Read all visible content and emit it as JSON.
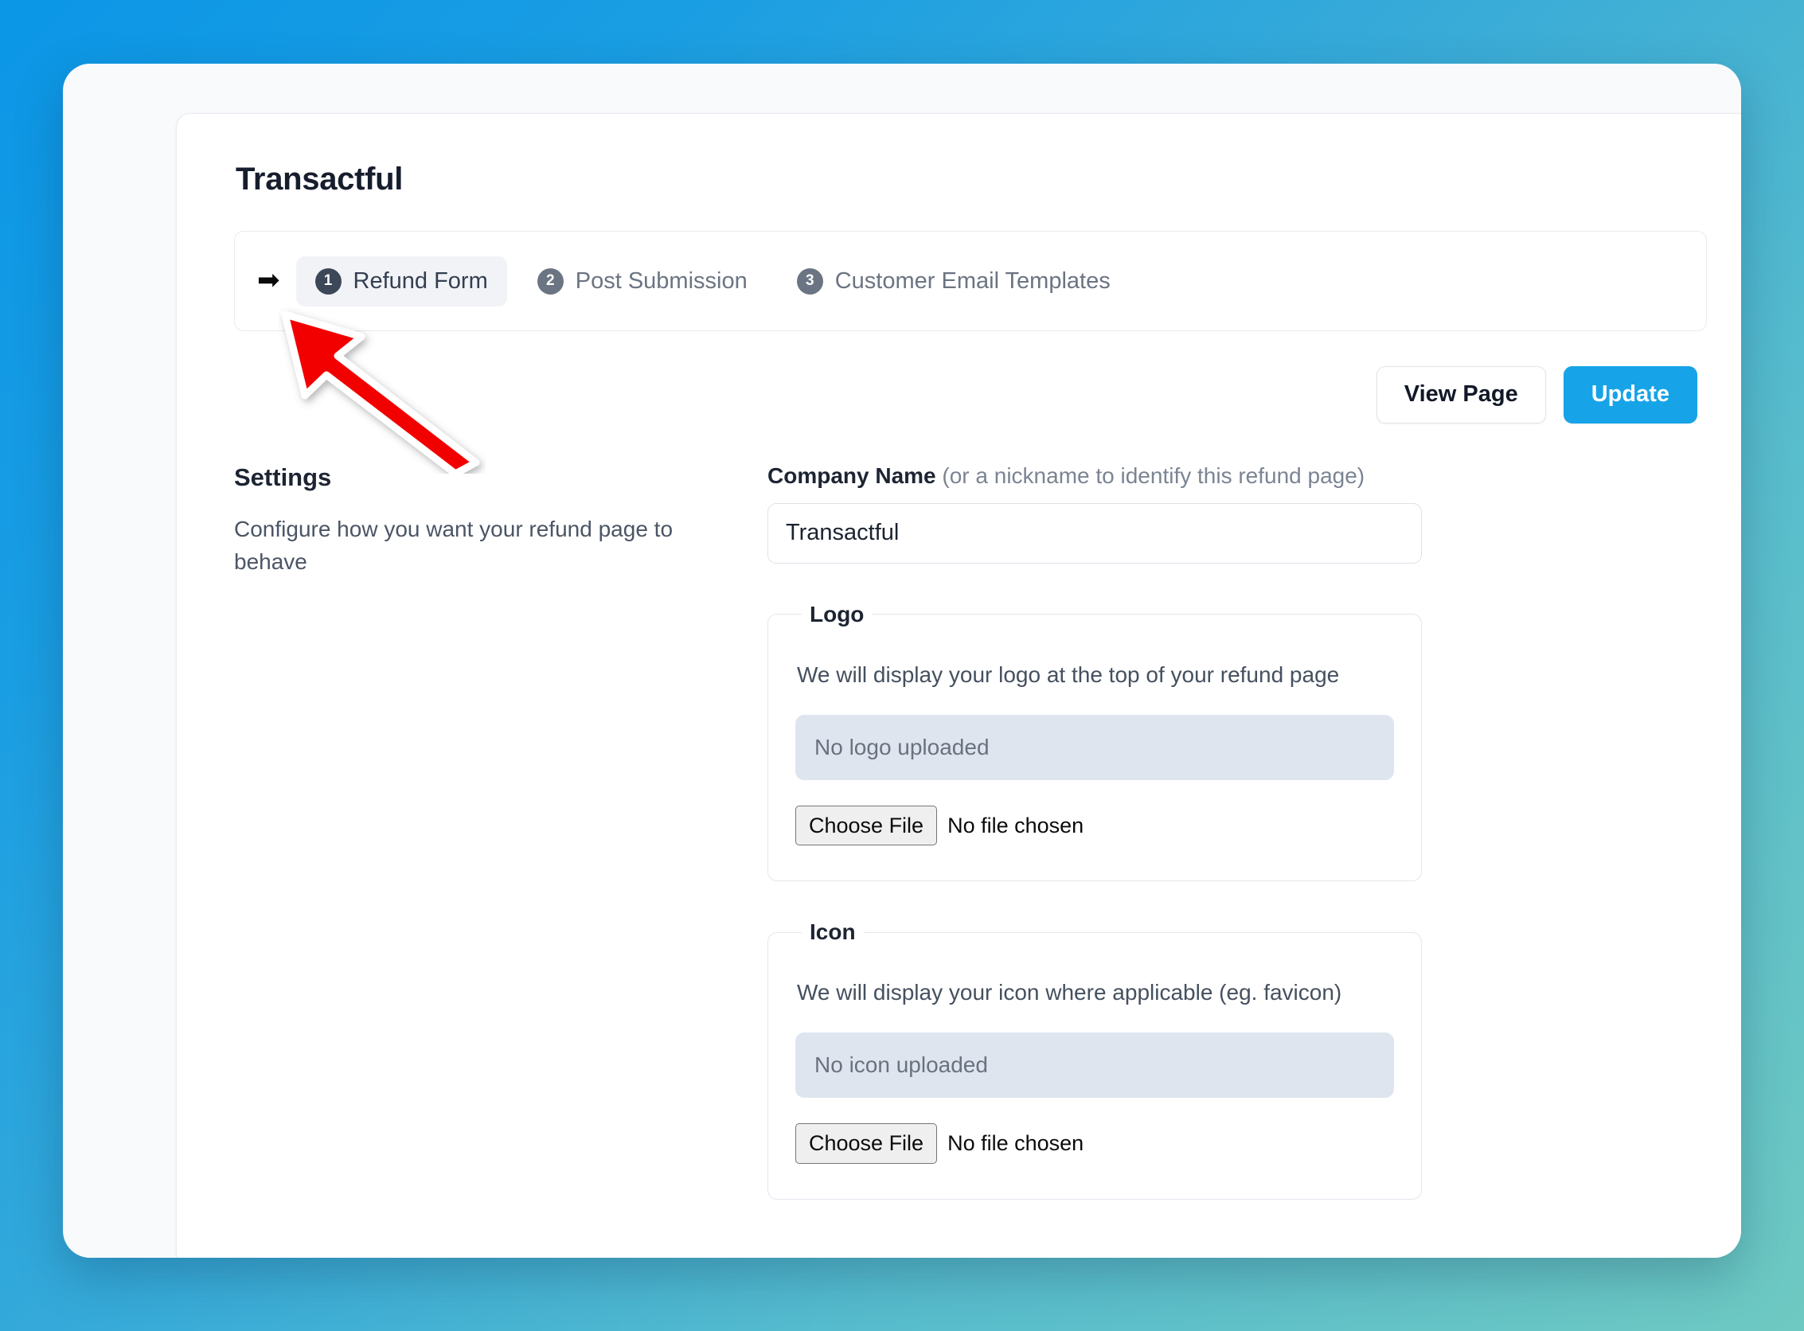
{
  "app": {
    "title": "Transactful",
    "background_start": "#0b96e6",
    "background_end": "#6ec9c2"
  },
  "steps": {
    "arrow_glyph": "➡",
    "items": [
      {
        "number": "1",
        "label": "Refund Form",
        "active": true
      },
      {
        "number": "2",
        "label": "Post Submission",
        "active": false
      },
      {
        "number": "3",
        "label": "Customer Email Templates",
        "active": false
      }
    ]
  },
  "actions": {
    "view_page_label": "View Page",
    "update_label": "Update",
    "primary_color": "#16a3e8"
  },
  "settings": {
    "title": "Settings",
    "description": "Configure how you want your refund page to behave"
  },
  "company_name": {
    "label": "Company Name",
    "hint": "(or a nickname to identify this refund page)",
    "value": "Transactful",
    "placeholder": "Company Name"
  },
  "logo": {
    "legend": "Logo",
    "description": "We will display your logo at the top of your refund page",
    "placeholder_text": "No logo uploaded",
    "choose_file_label": "Choose File",
    "file_status": "No file chosen"
  },
  "icon": {
    "legend": "Icon",
    "description": "We will display your icon where applicable (eg. favicon)",
    "placeholder_text": "No icon uploaded",
    "choose_file_label": "Choose File",
    "file_status": "No file chosen"
  },
  "annotation": {
    "type": "arrow",
    "color": "#f20000",
    "points_to": "Refund Form"
  }
}
